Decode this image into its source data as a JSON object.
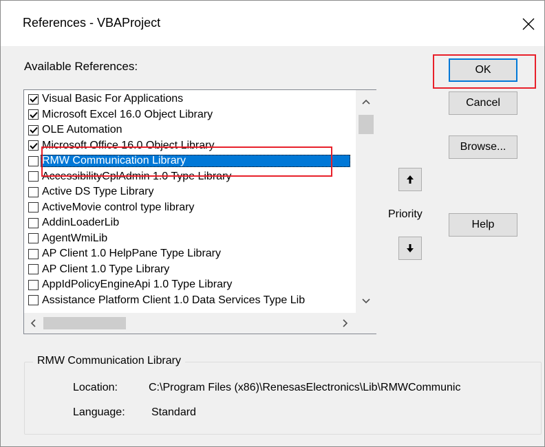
{
  "dialog": {
    "title": "References - VBAProject",
    "close_glyph": "✕"
  },
  "available_label": "Available References:",
  "references": [
    {
      "label": "Visual Basic For Applications",
      "checked": true,
      "selected": false
    },
    {
      "label": "Microsoft Excel 16.0 Object Library",
      "checked": true,
      "selected": false
    },
    {
      "label": "OLE Automation",
      "checked": true,
      "selected": false
    },
    {
      "label": "Microsoft Office 16.0 Object Library",
      "checked": true,
      "selected": false
    },
    {
      "label": "RMW Communication Library",
      "checked": false,
      "selected": true
    },
    {
      "label": "AccessibilityCplAdmin 1.0 Type Library",
      "checked": false,
      "selected": false
    },
    {
      "label": "Active DS Type Library",
      "checked": false,
      "selected": false
    },
    {
      "label": "ActiveMovie control type library",
      "checked": false,
      "selected": false
    },
    {
      "label": "AddinLoaderLib",
      "checked": false,
      "selected": false
    },
    {
      "label": "AgentWmiLib",
      "checked": false,
      "selected": false
    },
    {
      "label": "AP Client 1.0 HelpPane Type Library",
      "checked": false,
      "selected": false
    },
    {
      "label": "AP Client 1.0 Type Library",
      "checked": false,
      "selected": false
    },
    {
      "label": "AppIdPolicyEngineApi 1.0 Type Library",
      "checked": false,
      "selected": false
    },
    {
      "label": "Assistance Platform Client 1.0 Data Services Type Lib",
      "checked": false,
      "selected": false
    }
  ],
  "buttons": {
    "ok": "OK",
    "cancel": "Cancel",
    "browse": "Browse...",
    "help": "Help"
  },
  "priority_label": "Priority",
  "details": {
    "group_title": "RMW Communication Library",
    "location_label": "Location:",
    "location_value": "C:\\Program Files (x86)\\RenesasElectronics\\Lib\\RMWCommunic",
    "language_label": "Language:",
    "language_value": "Standard"
  },
  "colors": {
    "selection": "#0078d7",
    "annotation": "#e8202a"
  }
}
